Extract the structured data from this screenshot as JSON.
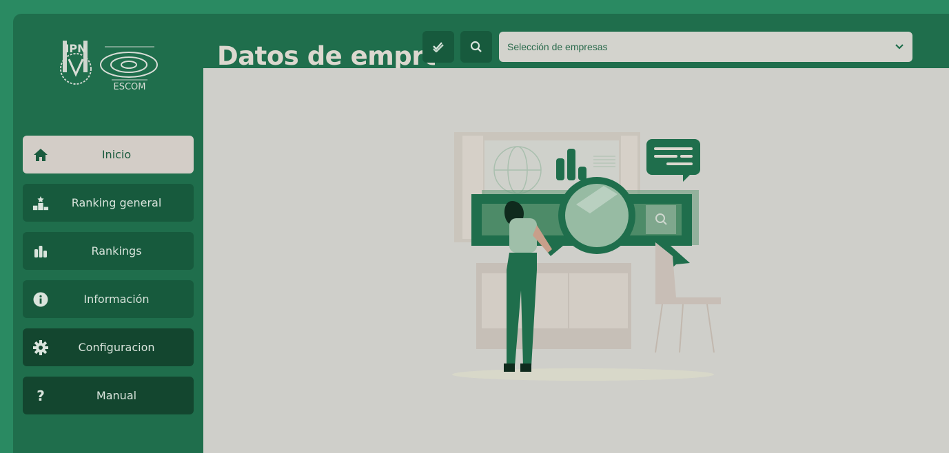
{
  "header": {
    "title": "Datos de empres",
    "select_placeholder": "Selección de empresas"
  },
  "logo": {
    "ipn_text": "IPN",
    "escom_text": "ESCOM"
  },
  "sidebar": {
    "items": [
      {
        "label": "Inicio",
        "icon": "home-icon"
      },
      {
        "label": "Ranking general",
        "icon": "podium-icon"
      },
      {
        "label": "Rankings",
        "icon": "bar-chart-icon"
      },
      {
        "label": "Información",
        "icon": "info-icon"
      },
      {
        "label": "Configuracion",
        "icon": "gear-icon"
      },
      {
        "label": "Manual",
        "icon": "question-icon"
      }
    ]
  },
  "colors": {
    "background": "#2a8a62",
    "frame": "#1f6e4c",
    "active_nav": "#d3cdc7",
    "panel": "#cfcfca"
  }
}
